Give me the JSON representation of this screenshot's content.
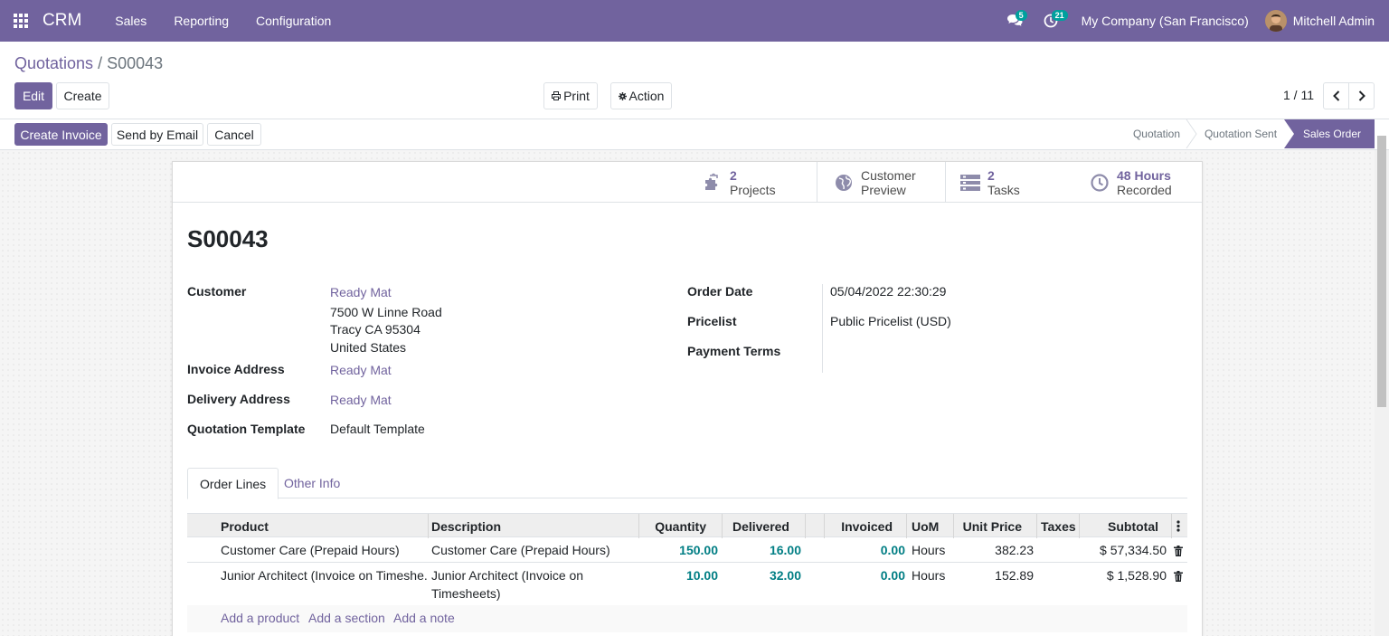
{
  "navbar": {
    "app_name": "CRM",
    "menu": [
      "Sales",
      "Reporting",
      "Configuration"
    ],
    "messages_count": "5",
    "activities_count": "21",
    "company": "My Company (San Francisco)",
    "user": "Mitchell Admin"
  },
  "breadcrumb": {
    "parent": "Quotations",
    "separator": "/",
    "current": "S00043"
  },
  "toolbar": {
    "edit": "Edit",
    "create": "Create",
    "print": "Print",
    "action": "Action",
    "pager": "1 / 11"
  },
  "status_actions": {
    "create_invoice": "Create Invoice",
    "send_email": "Send by Email",
    "cancel": "Cancel"
  },
  "stages": [
    "Quotation",
    "Quotation Sent",
    "Sales Order"
  ],
  "active_stage": "Sales Order",
  "smart_buttons": {
    "projects": {
      "num": "2",
      "label": "Projects",
      "icon": "puzzle-icon"
    },
    "preview": {
      "line1": "Customer",
      "line2": "Preview",
      "icon": "globe-icon"
    },
    "tasks": {
      "num": "2",
      "label": "Tasks",
      "icon": "tasks-icon"
    },
    "hours": {
      "num": "48 Hours",
      "label": "Recorded",
      "icon": "clock-icon"
    }
  },
  "record": {
    "name": "S00043",
    "labels": {
      "customer": "Customer",
      "invoice_address": "Invoice Address",
      "delivery_address": "Delivery Address",
      "quotation_template": "Quotation Template",
      "order_date": "Order Date",
      "pricelist": "Pricelist",
      "payment_terms": "Payment Terms"
    },
    "customer": "Ready Mat",
    "address_line1": "7500 W Linne Road",
    "address_line2": "Tracy CA 95304",
    "address_line3": "United States",
    "invoice_address": "Ready Mat",
    "delivery_address": "Ready Mat",
    "quotation_template": "Default Template",
    "order_date": "05/04/2022 22:30:29",
    "pricelist": "Public Pricelist (USD)",
    "payment_terms": ""
  },
  "tabs": {
    "order_lines": "Order Lines",
    "other_info": "Other Info"
  },
  "table": {
    "headers": {
      "product": "Product",
      "description": "Description",
      "quantity": "Quantity",
      "delivered": "Delivered",
      "invoiced": "Invoiced",
      "uom": "UoM",
      "unit_price": "Unit Price",
      "taxes": "Taxes",
      "subtotal": "Subtotal"
    },
    "rows": [
      {
        "product": "Customer Care (Prepaid Hours)",
        "description": "Customer Care (Prepaid Hours)",
        "description2": "",
        "quantity": "150.00",
        "delivered": "16.00",
        "invoiced": "0.00",
        "uom": "Hours",
        "unit_price": "382.23",
        "subtotal": "$ 57,334.50"
      },
      {
        "product": "Junior Architect (Invoice on Timeshe...",
        "description": "Junior Architect (Invoice on",
        "description2": "Timesheets)",
        "quantity": "10.00",
        "delivered": "32.00",
        "invoiced": "0.00",
        "uom": "Hours",
        "unit_price": "152.89",
        "subtotal": "$ 1,528.90"
      }
    ],
    "add_product": "Add a product",
    "add_section": "Add a section",
    "add_note": "Add a note"
  },
  "colors": {
    "brand": "#71639e",
    "teal": "#00a09d",
    "num": "#017e84"
  }
}
